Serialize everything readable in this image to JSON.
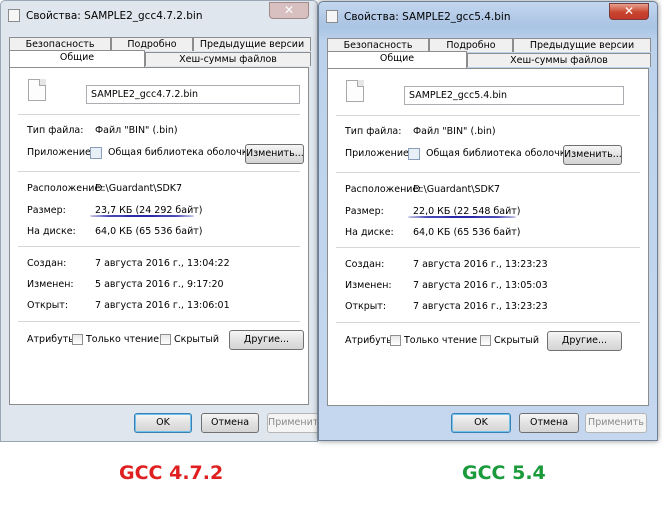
{
  "colors": {
    "gcc472": "#e02020",
    "gcc54": "#1a9a3a"
  },
  "left": {
    "title": "Свойства: SAMPLE2_gcc4.7.2.bin",
    "close": "✕",
    "tabs_row1": [
      "Безопасность",
      "Подробно",
      "Предыдущие версии"
    ],
    "tabs_row2": [
      "Общие",
      "Хеш-суммы файлов"
    ],
    "filename": "SAMPLE2_gcc4.7.2.bin",
    "type_label": "Тип файла:",
    "type_value": "Файл \"BIN\" (.bin)",
    "app_label": "Приложение:",
    "app_value": "Общая библиотека оболочки Wi",
    "app_button": "Изменить...",
    "loc_label": "Расположение:",
    "loc_value": "D:\\Guardant\\SDK7",
    "size_label": "Размер:",
    "size_value": "23,7 КБ (24 292 байт)",
    "disk_label": "На диске:",
    "disk_value": "64,0 КБ (65 536 байт)",
    "created_label": "Создан:",
    "created_value": "7 августа 2016 г., 13:04:22",
    "modified_label": "Изменен:",
    "modified_value": "5 августа 2016 г., 9:17:20",
    "opened_label": "Открыт:",
    "opened_value": "7 августа 2016 г., 13:06:01",
    "attr_label": "Атрибуты:",
    "readonly_label": "Только чтение",
    "hidden_label": "Скрытый",
    "other_button": "Другие...",
    "ok": "OK",
    "cancel": "Отмена",
    "apply": "Применить"
  },
  "right": {
    "title": "Свойства: SAMPLE2_gcc5.4.bin",
    "close": "✕",
    "tabs_row1": [
      "Безопасность",
      "Подробно",
      "Предыдущие версии"
    ],
    "tabs_row2": [
      "Общие",
      "Хеш-суммы файлов"
    ],
    "filename": "SAMPLE2_gcc5.4.bin",
    "type_label": "Тип файла:",
    "type_value": "Файл \"BIN\" (.bin)",
    "app_label": "Приложение:",
    "app_value": "Общая библиотека оболочки Wi",
    "app_button": "Изменить...",
    "loc_label": "Расположение:",
    "loc_value": "D:\\Guardant\\SDK7",
    "size_label": "Размер:",
    "size_value": "22,0 КБ (22 548 байт)",
    "disk_label": "На диске:",
    "disk_value": "64,0 КБ (65 536 байт)",
    "created_label": "Создан:",
    "created_value": "7 августа 2016 г., 13:23:23",
    "modified_label": "Изменен:",
    "modified_value": "7 августа 2016 г., 13:05:03",
    "opened_label": "Открыт:",
    "opened_value": "7 августа 2016 г., 13:23:23",
    "attr_label": "Атрибуты:",
    "readonly_label": "Только чтение",
    "hidden_label": "Скрытый",
    "other_button": "Другие...",
    "ok": "OK",
    "cancel": "Отмена",
    "apply": "Применить"
  },
  "captions": {
    "left": "GCC 4.7.2",
    "right": "GCC 5.4"
  }
}
